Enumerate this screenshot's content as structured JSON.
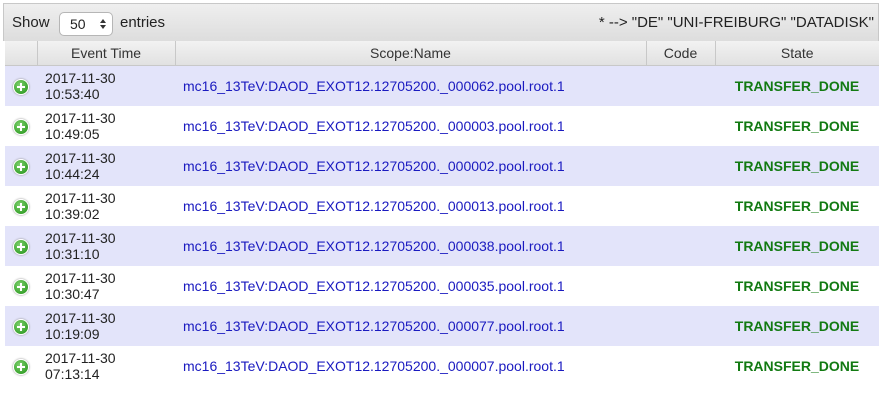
{
  "toolbar": {
    "show_label": "Show",
    "length_value": "50",
    "entries_label": "entries",
    "filter_text": "* --> \"DE\" \"UNI-FREIBURG\" \"DATADISK\""
  },
  "table": {
    "headers": {
      "event_time": "Event Time",
      "scope_name": "Scope:Name",
      "code": "Code",
      "state": "State"
    },
    "rows": [
      {
        "date": "2017-11-30",
        "time": "10:53:40",
        "name": "mc16_13TeV:DAOD_EXOT12.12705200._000062.pool.root.1",
        "code": "",
        "state": "TRANSFER_DONE"
      },
      {
        "date": "2017-11-30",
        "time": "10:49:05",
        "name": "mc16_13TeV:DAOD_EXOT12.12705200._000003.pool.root.1",
        "code": "",
        "state": "TRANSFER_DONE"
      },
      {
        "date": "2017-11-30",
        "time": "10:44:24",
        "name": "mc16_13TeV:DAOD_EXOT12.12705200._000002.pool.root.1",
        "code": "",
        "state": "TRANSFER_DONE"
      },
      {
        "date": "2017-11-30",
        "time": "10:39:02",
        "name": "mc16_13TeV:DAOD_EXOT12.12705200._000013.pool.root.1",
        "code": "",
        "state": "TRANSFER_DONE"
      },
      {
        "date": "2017-11-30",
        "time": "10:31:10",
        "name": "mc16_13TeV:DAOD_EXOT12.12705200._000038.pool.root.1",
        "code": "",
        "state": "TRANSFER_DONE"
      },
      {
        "date": "2017-11-30",
        "time": "10:30:47",
        "name": "mc16_13TeV:DAOD_EXOT12.12705200._000035.pool.root.1",
        "code": "",
        "state": "TRANSFER_DONE"
      },
      {
        "date": "2017-11-30",
        "time": "10:19:09",
        "name": "mc16_13TeV:DAOD_EXOT12.12705200._000077.pool.root.1",
        "code": "",
        "state": "TRANSFER_DONE"
      },
      {
        "date": "2017-11-30",
        "time": "07:13:14",
        "name": "mc16_13TeV:DAOD_EXOT12.12705200._000007.pool.root.1",
        "code": "",
        "state": "TRANSFER_DONE"
      }
    ]
  },
  "icons": {
    "expand": "plus-circle-icon",
    "select_arrows": "up-down-arrows-icon"
  },
  "colors": {
    "link": "#1a1ac0",
    "state_ok": "#127a12",
    "row_stripe": "#e3e4fa",
    "expand_icon": "#3aa32e"
  }
}
